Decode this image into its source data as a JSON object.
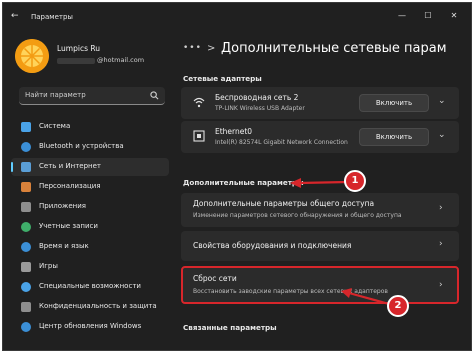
{
  "window": {
    "title": "Параметры",
    "controls": {
      "back": "←",
      "minimize": "—",
      "maximize": "☐",
      "close": "✕"
    }
  },
  "account": {
    "name": "Lumpics Ru",
    "email": "@hotmail.com"
  },
  "search": {
    "placeholder": "Найти параметр"
  },
  "sidebar": {
    "items": [
      {
        "label": "Система",
        "icon": "system-icon",
        "color": "#4aa3e8"
      },
      {
        "label": "Bluetooth и устройства",
        "icon": "bluetooth-icon",
        "color": "#3b8fd6"
      },
      {
        "label": "Сеть и Интернет",
        "icon": "network-icon",
        "color": "#5a9ed6",
        "selected": true
      },
      {
        "label": "Персонализация",
        "icon": "brush-icon",
        "color": "#d9823b"
      },
      {
        "label": "Приложения",
        "icon": "apps-icon",
        "color": "#8e8e8e"
      },
      {
        "label": "Учетные записи",
        "icon": "accounts-icon",
        "color": "#3fae6a"
      },
      {
        "label": "Время и язык",
        "icon": "clock-globe-icon",
        "color": "#3b8fd6"
      },
      {
        "label": "Игры",
        "icon": "gamepad-icon",
        "color": "#9a9a9a"
      },
      {
        "label": "Специальные возможности",
        "icon": "accessibility-icon",
        "color": "#4aa3e8"
      },
      {
        "label": "Конфиденциальность и защита",
        "icon": "shield-icon",
        "color": "#8e8e8e"
      },
      {
        "label": "Центр обновления Windows",
        "icon": "update-icon",
        "color": "#3b8fd6"
      }
    ]
  },
  "main": {
    "breadcrumb_dots": "•••",
    "breadcrumb_sep": ">",
    "page_title": "Дополнительные сетевые парам",
    "adapters_header": "Сетевые адаптеры",
    "adapters": [
      {
        "name": "Беспроводная сеть 2",
        "desc": "TP-LINK Wireless USB Adapter",
        "button": "Включить",
        "icon": "wifi-icon"
      },
      {
        "name": "Ethernet0",
        "desc": "Intel(R) 82574L Gigabit Network Connection",
        "button": "Включить",
        "icon": "ethernet-icon"
      }
    ],
    "advanced_header": "Дополнительные параметры",
    "advanced": [
      {
        "title": "Дополнительные параметры общего доступа",
        "desc": "Изменение параметров сетевого обнаружения и общего доступа"
      },
      {
        "title": "Свойства оборудования и подключения",
        "desc": ""
      },
      {
        "title": "Сброс сети",
        "desc": "Восстановить заводские параметры всех сетевых адаптеров"
      }
    ],
    "related_header": "Связанные параметры"
  },
  "annotations": {
    "badge1": "1",
    "badge2": "2",
    "color": "#d7262b"
  }
}
